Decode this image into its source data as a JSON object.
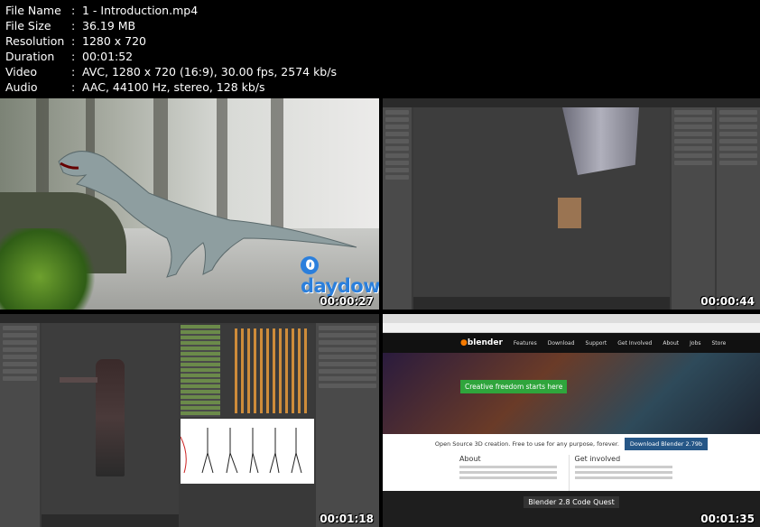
{
  "file_info": [
    {
      "key": "File Name",
      "sep": ":",
      "value": "1 - Introduction.mp4"
    },
    {
      "key": "File Size",
      "sep": ":",
      "value": "36.19 MB"
    },
    {
      "key": "Resolution",
      "sep": ":",
      "value": "1280 x 720"
    },
    {
      "key": "Duration",
      "sep": ":",
      "value": "00:01:52"
    },
    {
      "key": "Video",
      "sep": ":",
      "value": "AVC, 1280 x 720 (16:9), 30.00 fps, 2574 kb/s"
    },
    {
      "key": "Audio",
      "sep": ":",
      "value": "AAC, 44100 Hz, stereo, 128 kb/s"
    }
  ],
  "thumbnails": {
    "t1": {
      "timestamp": "00:00:27",
      "watermark_o": "0",
      "watermark": "daydown.com"
    },
    "t2": {
      "timestamp": "00:00:44"
    },
    "t3": {
      "timestamp": "00:01:18"
    },
    "t4": {
      "timestamp": "00:01:35",
      "logo": "blender",
      "nav": [
        "Features",
        "Download",
        "Support",
        "Get Involved",
        "About",
        "Jobs",
        "Store"
      ],
      "hero_button": "Creative freedom starts here",
      "tagline": "Open Source 3D creation. Free to use for any purpose, forever.",
      "download": "Download Blender 2.79b",
      "about_title": "About",
      "involved_title": "Get involved",
      "quest": "Blender 2.8 Code Quest"
    }
  },
  "colors": {
    "background": "#000000",
    "text": "#ffffff",
    "watermark": "#2b7fdc",
    "blender_orange": "#f57a00"
  }
}
